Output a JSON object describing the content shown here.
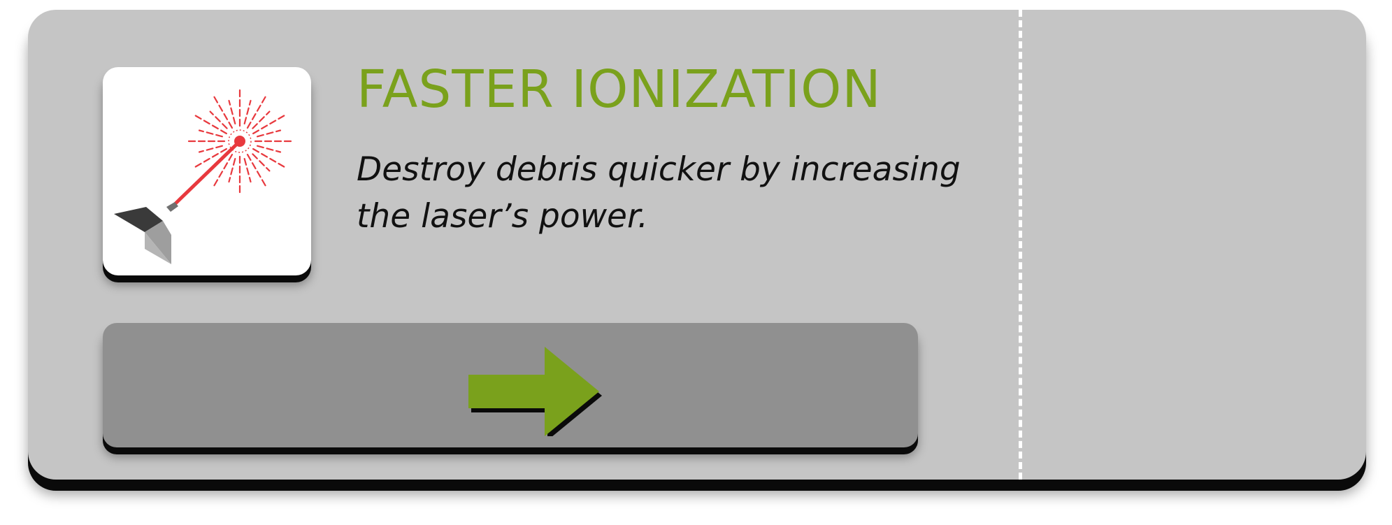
{
  "upgrade": {
    "title": "FASTER IONIZATION",
    "description": "Destroy debris quicker by increasing the laser’s power.",
    "icon": "laser-cannon-icon",
    "action_icon": "arrow-right-icon"
  },
  "colors": {
    "card_background": "#c5c5c5",
    "title": "#7aa11c",
    "button_background": "#909090",
    "arrow": "#7aa11c",
    "laser": "#e8393e",
    "divider": "#ffffff"
  }
}
